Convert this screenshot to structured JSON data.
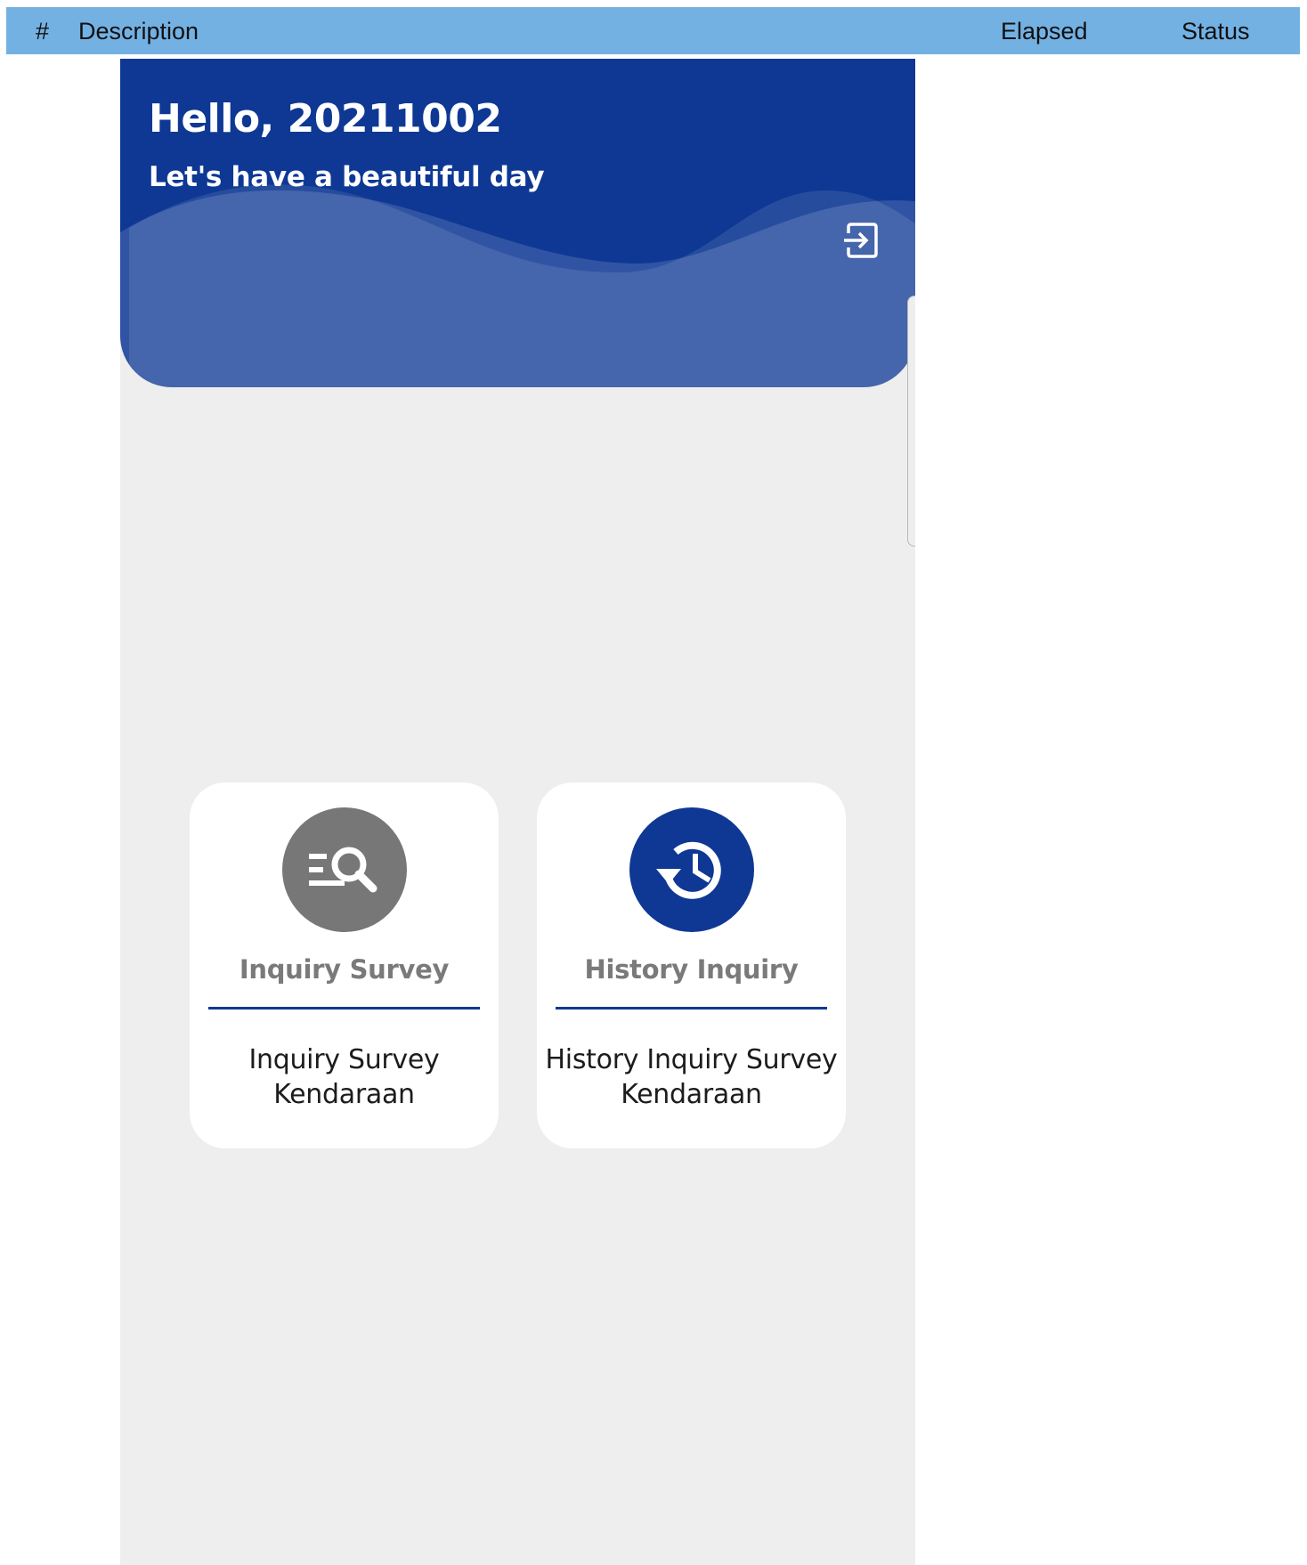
{
  "report_header": {
    "col_num": "#",
    "col_description": "Description",
    "col_elapsed": "Elapsed",
    "col_status": "Status"
  },
  "app": {
    "greeting": "Hello, 20211002",
    "subgreeting": "Let's have a beautiful day",
    "logout_icon": "exit-to-app-icon"
  },
  "menu": [
    {
      "title": "Inquiry Survey",
      "description": "Inquiry Survey Kendaraan",
      "icon": "search-list-icon",
      "icon_color": "#777777"
    },
    {
      "title": "History Inquiry",
      "description": "History Inquiry Survey Kendaraan",
      "icon": "history-icon",
      "icon_color": "#0e3894"
    }
  ],
  "colors": {
    "header_bar": "#74b1e3",
    "primary": "#0e3894",
    "background": "#eeeeee",
    "card": "#ffffff"
  }
}
